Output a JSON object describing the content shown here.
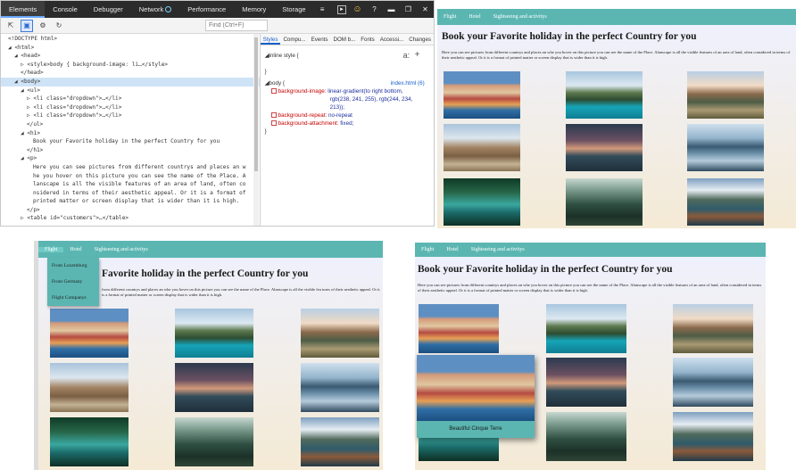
{
  "devtools": {
    "tabs": [
      "Elements",
      "Console",
      "Debugger",
      "Network",
      "Performance",
      "Memory",
      "Storage"
    ],
    "find_placeholder": "Find (Ctrl+F)",
    "dom_lines": [
      {
        "indent": 0,
        "text": "<!DOCTYPE html>"
      },
      {
        "indent": 0,
        "text": "◢ <html>"
      },
      {
        "indent": 1,
        "text": "◢ <head>"
      },
      {
        "indent": 2,
        "text": "▷ <style>body { background-image: li…</style>"
      },
      {
        "indent": 2,
        "text": "</head>"
      },
      {
        "indent": 1,
        "text": "◢ <body>",
        "selected": true
      },
      {
        "indent": 2,
        "text": "◢ <ul>"
      },
      {
        "indent": 3,
        "text": "▷ <li class=\"dropdown\">…</li>"
      },
      {
        "indent": 3,
        "text": "▷ <li class=\"dropdown\">…</li>"
      },
      {
        "indent": 3,
        "text": "▷ <li class=\"dropdown\">…</li>"
      },
      {
        "indent": 3,
        "text": "</ul>"
      },
      {
        "indent": 2,
        "text": "◢ <h1>"
      },
      {
        "indent": 4,
        "text": "Book your Favorite holiday in the perfect Country for you"
      },
      {
        "indent": 3,
        "text": "</h1>"
      },
      {
        "indent": 2,
        "text": "◢ <p>"
      },
      {
        "indent": 4,
        "text": "Here you can see pictures from different countrys and places an w"
      },
      {
        "indent": 4,
        "text": "he you hover on this picture you can see the name of the Place. A"
      },
      {
        "indent": 4,
        "text": "lanscape is all the visible features of an area of land, often co"
      },
      {
        "indent": 4,
        "text": "nsidered in terms of their aesthetic appeal. Or it is a format of"
      },
      {
        "indent": 4,
        "text": "printed matter or screen display that is wider than it is high."
      },
      {
        "indent": 3,
        "text": "</p>"
      },
      {
        "indent": 2,
        "text": "▷ <table id=\"customers\">…</table>"
      }
    ],
    "styles_tabs": [
      "Styles",
      "Compu...",
      "Events",
      "DOM b...",
      "Fonts",
      "Accessi...",
      "Changes"
    ],
    "inline_style_label": "◢inline style  {",
    "inline_style_close": "}",
    "rule_selector": "◢body  {",
    "rule_source": "index.html (6)",
    "rule_props": [
      {
        "name": "background-image:",
        "value": "linear-gradient(to right bottom,"
      },
      {
        "name": "",
        "value": "rgb(238, 241, 255), rgb(244, 234,"
      },
      {
        "name": "",
        "value": "213));"
      },
      {
        "name": "background-repeat:",
        "value": "no-repeat"
      },
      {
        "name": "background-attachment:",
        "value": "fixed;"
      }
    ],
    "rule_close": "}",
    "new_rule_label": "a:",
    "add_label": "+"
  },
  "site": {
    "nav": [
      "Flight",
      "Hotel",
      "Sightseeing and activitys"
    ],
    "title": "Book your Favorite holiday in the perfect Country for you",
    "title_partial": "Favorite holiday in the perfect Country for you",
    "description": "Here you can see pictures from different countrys and places an whe you hover on this picture you can see the name of the Place. Alanscape is all the visible features of an area of land, often considered in terms of their aesthetic appeal. Or it is a format of printed matter or screen display that is wider than it is high.",
    "description_partial": "from different countrys and places an whe you hover on this picture you can see the name of the Place. Alanscape is all the visible fea tures of their aesthetic appeal. Or it is a format of printed matter or screen display that is wider than it is high.",
    "photos": [
      "town",
      "lake",
      "mtnsun",
      "canyon",
      "dusk",
      "mirror",
      "river",
      "forest",
      "alpine"
    ],
    "dropdown_items": [
      "From Luxemburg",
      "From Germany",
      "Flight Companys"
    ],
    "hover_caption": "Beautiful Cinque Terre"
  }
}
